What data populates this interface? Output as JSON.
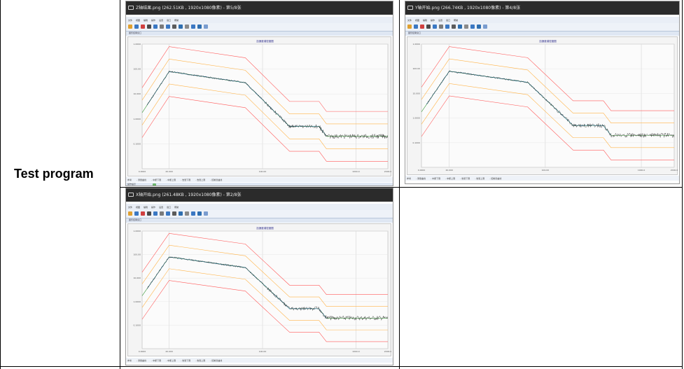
{
  "row_label": "Test program",
  "panels": [
    {
      "title": "Z轴结果.png (262.51KB , 1920x1080像素) - 第5/8张",
      "menu": [
        "文件",
        "视图",
        "编辑",
        "操作",
        "设置",
        "窗口",
        "帮助"
      ],
      "subbar": "图形结果窗口",
      "plot_title": "加速度谱密度图",
      "x_ticks": [
        "0.0000",
        "20.000",
        "100.00",
        "1000.0",
        "2000.0"
      ],
      "y_ticks": [
        "1.0000",
        "100.00",
        "10.000",
        "1.0000",
        "0.1000"
      ],
      "legend": [
        "参考",
        "- 测量曲线",
        "- 中断下限",
        "- 中断上限",
        "- 告警下限",
        "- 告警上限",
        "- 控制谱曲线"
      ],
      "status": "操作提示"
    },
    {
      "title": "Y轴开始.png (266.74KB , 1920x1080像素) - 第4/8张",
      "menu": [
        "文件",
        "视图",
        "编辑",
        "操作",
        "设置",
        "窗口",
        "帮助"
      ],
      "subbar": "图形结果窗口",
      "plot_title": "加速度谱密度图",
      "x_ticks": [
        "0.0000",
        "20.000",
        "100.00",
        "1000.0",
        "2000.0"
      ],
      "y_ticks": [
        "1.0000",
        "100.00",
        "10.000",
        "1.0000",
        "0.1000"
      ],
      "legend": [
        "参考",
        "- 测量曲线",
        "- 中断下限",
        "- 中断上限",
        "- 告警下限",
        "- 告警上限",
        "- 控制谱曲线"
      ],
      "status": ""
    },
    {
      "title": "X轴开始.png (261.48KB , 1920x1080像素) - 第2/8张",
      "menu": [
        "文件",
        "视图",
        "编辑",
        "操作",
        "设置",
        "窗口",
        "帮助"
      ],
      "subbar": "图形结果窗口",
      "plot_title": "加速度谱密度图",
      "x_ticks": [
        "0.0000",
        "20.000",
        "100.00",
        "1000.0",
        "2000.0"
      ],
      "y_ticks": [
        "1.0000",
        "100.00",
        "10.000",
        "1.0000",
        "0.1000"
      ],
      "legend": [
        "参考",
        "- 测量曲线",
        "- 中断下限",
        "- 中断上限",
        "- 告警下限",
        "- 告警上限",
        "- 控制谱曲线"
      ],
      "status": ""
    }
  ],
  "colors": {
    "abort_limit": "#ff5a5a",
    "alarm_limit": "#ffb347",
    "reference": "#3a9a3a",
    "control": "#1a5fb4",
    "measured": "#111111"
  }
}
